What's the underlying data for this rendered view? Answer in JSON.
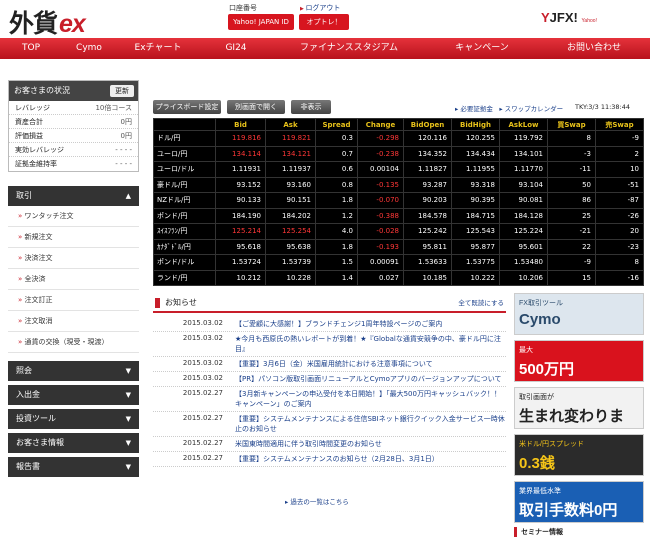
{
  "header": {
    "logo_main": "外貨",
    "logo_ex": "ex",
    "account_label": "口座番号",
    "logout": "ログアウト",
    "yahoo_id": "Yahoo! JAPAN ID",
    "options": "オプトレ！",
    "yjfx_a": "Y",
    "yjfx_b": "JFX!",
    "yjfx_tag": "Yahoo!"
  },
  "nav": [
    "TOP",
    "Cymo",
    "Exチャート",
    "GI24",
    "ファイナンススタジアム",
    "キャンペーン",
    "お問い合わせ"
  ],
  "status": {
    "title": "お客さまの状況",
    "refresh": "更新",
    "rows": [
      [
        "レバレッジ",
        "10倍コース"
      ],
      [
        "資産合計",
        "0円"
      ],
      [
        "評価損益",
        "0円"
      ],
      [
        "実効レバレッジ",
        "- - - -"
      ],
      [
        "証拠金維持率",
        "- - - -"
      ]
    ]
  },
  "menu": {
    "trade": "取引",
    "trade_items": [
      "ワンタッチ注文",
      "新規注文",
      "決済注文",
      "全決済",
      "注文訂正",
      "注文取消",
      "通貨の交換（現受・現渡）"
    ],
    "sections": [
      "照会",
      "入出金",
      "投資ツール",
      "お客さま情報",
      "報告書"
    ]
  },
  "toolbar": {
    "price_board": "プライスボード設定",
    "open_window": "別画面で開く",
    "hide": "非表示",
    "links": "▸ 必要証拠金　▸ スワップカレンダー",
    "clock": "TKY:3/3 11:38:44"
  },
  "rates": {
    "headers": [
      "",
      "Bid",
      "Ask",
      "Spread",
      "Change",
      "BidOpen",
      "BidHigh",
      "AskLow",
      "買Swap",
      "売Swap"
    ],
    "rows": [
      [
        "ドル/円",
        "119.816",
        "119.821",
        "0.3",
        "-0.298",
        "120.116",
        "120.255",
        "119.792",
        "8",
        "-9"
      ],
      [
        "ユーロ/円",
        "134.114",
        "134.121",
        "0.7",
        "-0.238",
        "134.352",
        "134.434",
        "134.101",
        "-3",
        "2"
      ],
      [
        "ユーロ/ドル",
        "1.11931",
        "1.11937",
        "0.6",
        "0.00104",
        "1.11827",
        "1.11955",
        "1.11770",
        "-11",
        "10"
      ],
      [
        "豪ドル/円",
        "93.152",
        "93.160",
        "0.8",
        "-0.135",
        "93.287",
        "93.318",
        "93.104",
        "50",
        "-51"
      ],
      [
        "NZドル/円",
        "90.133",
        "90.151",
        "1.8",
        "-0.070",
        "90.203",
        "90.395",
        "90.081",
        "86",
        "-87"
      ],
      [
        "ポンド/円",
        "184.190",
        "184.202",
        "1.2",
        "-0.388",
        "184.578",
        "184.715",
        "184.128",
        "25",
        "-26"
      ],
      [
        "ｽｲｽﾌﾗﾝ/円",
        "125.214",
        "125.254",
        "4.0",
        "-0.028",
        "125.242",
        "125.543",
        "125.224",
        "-21",
        "20"
      ],
      [
        "ｶﾅﾀﾞﾄﾞﾙ/円",
        "95.618",
        "95.638",
        "1.8",
        "-0.193",
        "95.811",
        "95.877",
        "95.601",
        "22",
        "-23"
      ],
      [
        "ポンド/ドル",
        "1.53724",
        "1.53739",
        "1.5",
        "0.00091",
        "1.53633",
        "1.53775",
        "1.53480",
        "-9",
        "8"
      ],
      [
        "ランド/円",
        "10.212",
        "10.228",
        "1.4",
        "0.027",
        "10.185",
        "10.222",
        "10.206",
        "15",
        "-16"
      ]
    ]
  },
  "news": {
    "title": "お知らせ",
    "list_link": "全て既読にする",
    "past": "過去の一覧はこちら",
    "items": [
      [
        "2015.03.02",
        "【ご愛顧に大感謝！】ブランドチェンジ1周年特設ページのご案内"
      ],
      [
        "2015.03.02",
        "★今月も西原氏の熱いレポートが到着！★『Globalな通貨安競争の中、豪ドル円に注目』"
      ],
      [
        "2015.03.02",
        "【重要】3月6日（金）米国雇用統計における注意事項について"
      ],
      [
        "2015.03.02",
        "【PR】パソコン版取引画面リニューアルとCymoアプリのバージョンアップについて"
      ],
      [
        "2015.02.27",
        "【3月新キャンペーンの申込受付を本日開始！】「最大500万円キャッシュバック！！キャンペーン」のご案内"
      ],
      [
        "2015.02.27",
        "【重要】システムメンテナンスによる住信SBIネット銀行クイック入金サービス一時休止のお知らせ"
      ],
      [
        "2015.02.27",
        "米国東時間適用に伴う取引時間変更のお知らせ"
      ],
      [
        "2015.02.27",
        "【重要】システムメンテナンスのお知らせ（2月28日、3月1日）"
      ]
    ]
  },
  "ads": [
    {
      "l1": "FX取引ツール",
      "l2": "Cymo",
      "bg": "#dde6ee",
      "fg": "#2a4a6b"
    },
    {
      "l1": "最大",
      "l2": "500万円",
      "bg": "#d9121d",
      "fg": "#ffffff"
    },
    {
      "l1": "取引画面が",
      "l2": "生まれ変わります。",
      "bg": "#f2f2f2",
      "fg": "#222"
    },
    {
      "l1": "米ドル/円スプレッド",
      "l2": "0.3銭",
      "bg": "#2b2b2b",
      "fg": "#f5c518"
    },
    {
      "l1": "業界最低水準",
      "l2": "取引手数料0円",
      "bg": "#1a5fb4",
      "fg": "#ffffff"
    }
  ],
  "ads_footer": "セミナー情報"
}
